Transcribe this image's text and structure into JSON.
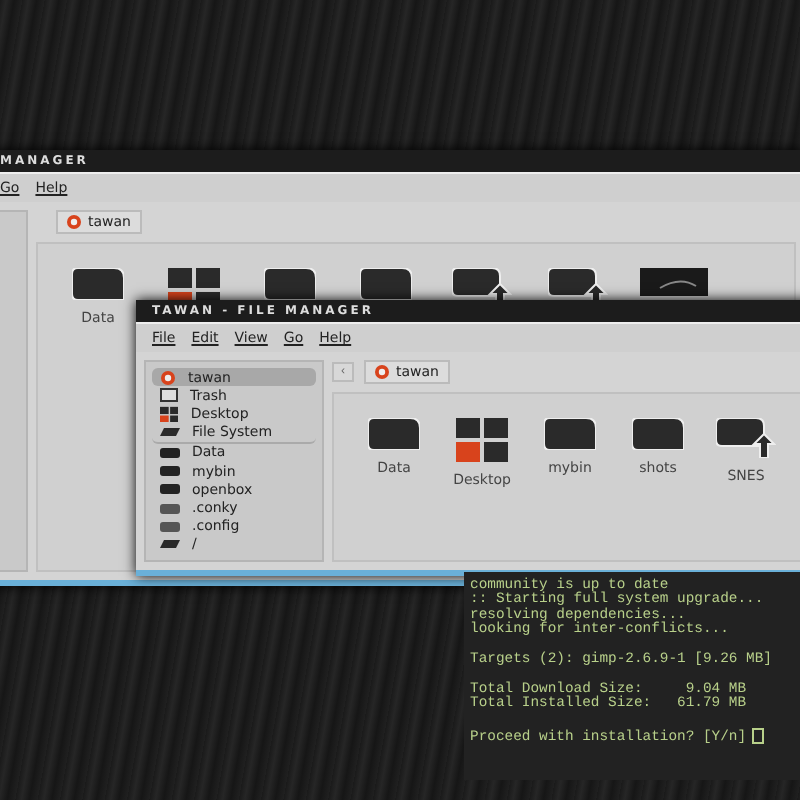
{
  "back_window": {
    "title": "MANAGER",
    "menu": [
      "Go",
      "Help"
    ],
    "location": "tawan",
    "icons": [
      {
        "kind": "folder",
        "label": "Data"
      },
      {
        "kind": "desktop"
      },
      {
        "kind": "folder"
      },
      {
        "kind": "folder"
      },
      {
        "kind": "link"
      },
      {
        "kind": "link"
      },
      {
        "kind": "image"
      }
    ]
  },
  "front_window": {
    "title": "TAWAN - FILE MANAGER",
    "menu": [
      "File",
      "Edit",
      "View",
      "Go",
      "Help"
    ],
    "sidebar": [
      {
        "kind": "home",
        "label": "tawan",
        "selected": true
      },
      {
        "kind": "trash",
        "label": "Trash",
        "selected": false
      },
      {
        "kind": "desktop",
        "label": "Desktop",
        "selected": false
      },
      {
        "kind": "drive",
        "label": "File System",
        "selected": false
      },
      {
        "kind": "folder",
        "label": "Data",
        "selected": false
      },
      {
        "kind": "folder",
        "label": "mybin",
        "selected": false
      },
      {
        "kind": "folder",
        "label": "openbox",
        "selected": false
      },
      {
        "kind": "hidden",
        "label": ".conky",
        "selected": false
      },
      {
        "kind": "hidden",
        "label": ".config",
        "selected": false
      },
      {
        "kind": "drive",
        "label": "/",
        "selected": false
      }
    ],
    "back_button": "‹",
    "location": "tawan",
    "icons": [
      {
        "kind": "folder",
        "label": "Data"
      },
      {
        "kind": "desktop",
        "label": "Desktop"
      },
      {
        "kind": "folder",
        "label": "mybin"
      },
      {
        "kind": "folder",
        "label": "shots"
      },
      {
        "kind": "link",
        "label": "SNES"
      }
    ]
  },
  "terminal": {
    "blocks": [
      [
        "community is up to date",
        ":: Starting full system upgrade...",
        "resolving dependencies...",
        "looking for inter-conflicts..."
      ],
      [
        "Targets (2): gimp-2.6.9-1 [9.26 MB]"
      ],
      [
        "Total Download Size:     9.04 MB",
        "Total Installed Size:   61.79 MB"
      ],
      [
        "Proceed with installation? [Y/n]"
      ]
    ]
  }
}
